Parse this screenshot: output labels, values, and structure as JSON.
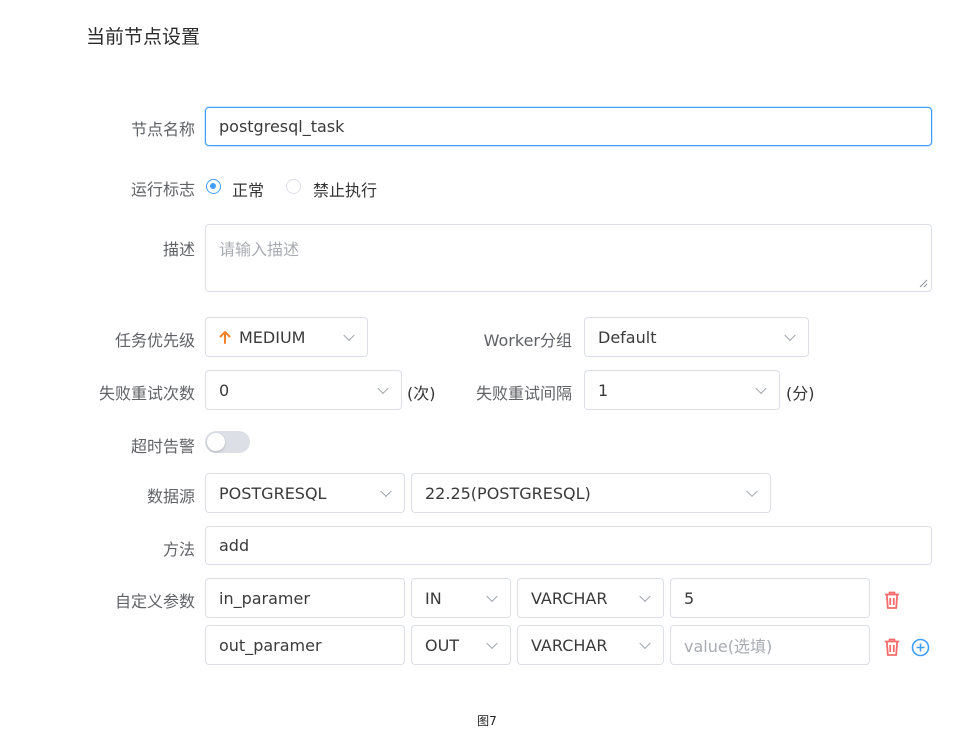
{
  "page_title": "当前节点设置",
  "node_name": {
    "label": "节点名称",
    "value": "postgresql_task"
  },
  "run_flag": {
    "label": "运行标志",
    "options": [
      "正常",
      "禁止执行"
    ],
    "selected": "正常"
  },
  "description": {
    "label": "描述",
    "placeholder": "请输入描述"
  },
  "priority": {
    "label": "任务优先级",
    "value": "MEDIUM",
    "icon": "arrow-up-icon",
    "icon_color": "#f5802a"
  },
  "worker_group": {
    "label": "Worker分组",
    "value": "Default"
  },
  "fail_retry_times": {
    "label": "失败重试次数",
    "value": "0",
    "unit": "(次)"
  },
  "fail_retry_interval": {
    "label": "失败重试间隔",
    "value": "1",
    "unit": "(分)"
  },
  "timeout_alarm": {
    "label": "超时告警",
    "enabled": false
  },
  "datasource": {
    "label": "数据源",
    "type": "POSTGRESQL",
    "instance": "22.25(POSTGRESQL)"
  },
  "method": {
    "label": "方法",
    "value": "add"
  },
  "custom_params": {
    "label": "自定义参数",
    "rows": [
      {
        "name": "in_paramer",
        "direction": "IN",
        "type": "VARCHAR",
        "value": "5",
        "placeholder": ""
      },
      {
        "name": "out_paramer",
        "direction": "OUT",
        "type": "VARCHAR",
        "value": "",
        "placeholder": "value(选填)"
      }
    ]
  },
  "colors": {
    "accent": "#409eff",
    "delete": "#f56c6c",
    "border": "#dcdfe6"
  },
  "caption": "图7"
}
